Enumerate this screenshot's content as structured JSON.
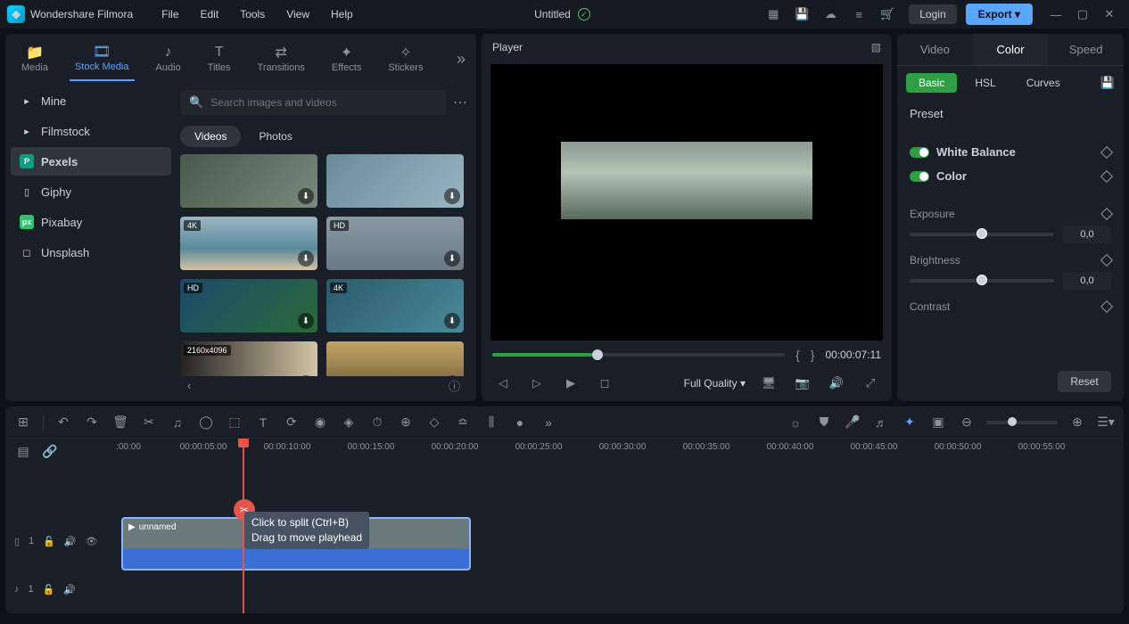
{
  "app": {
    "name": "Wondershare Filmora",
    "doc_title": "Untitled"
  },
  "menus": [
    "File",
    "Edit",
    "Tools",
    "View",
    "Help"
  ],
  "titlebar": {
    "login": "Login",
    "export": "Export ▾"
  },
  "tabs": {
    "media": "Media",
    "stock": "Stock Media",
    "audio": "Audio",
    "titles": "Titles",
    "transitions": "Transitions",
    "effects": "Effects",
    "stickers": "Stickers"
  },
  "sidebar": {
    "mine": "Mine",
    "filmstock": "Filmstock",
    "pexels": "Pexels",
    "giphy": "Giphy",
    "pixabay": "Pixabay",
    "unsplash": "Unsplash"
  },
  "search": {
    "placeholder": "Search images and videos"
  },
  "subtabs": {
    "videos": "Videos",
    "photos": "Photos"
  },
  "thumbs": {
    "b4k": "4K",
    "bhd": "HD",
    "bsize": "2160x4096"
  },
  "player": {
    "title": "Player",
    "timecode": "00:00:07:11",
    "quality": "Full Quality ▾"
  },
  "inspector": {
    "tabs": {
      "video": "Video",
      "color": "Color",
      "speed": "Speed"
    },
    "subtabs": {
      "basic": "Basic",
      "hsl": "HSL",
      "curves": "Curves"
    },
    "preset": "Preset",
    "wb": "White Balance",
    "color": "Color",
    "exposure": "Exposure",
    "brightness": "Brightness",
    "contrast": "Contrast",
    "zero": "0,0",
    "reset": "Reset"
  },
  "timeline": {
    "ticks": [
      ":00:00",
      "00:00:05:00",
      "00:00:10:00",
      "00:00:15:00",
      "00:00:20:00",
      "00:00:25:00",
      "00:00:30:00",
      "00:00:35:00",
      "00:00:40:00",
      "00:00:45:00",
      "00:00:50:00",
      "00:00:55:00"
    ],
    "clip_name": "unnamed",
    "tooltip_l1": "Click to split (Ctrl+B)",
    "tooltip_l2": "Drag to move playhead",
    "vtrack": "1",
    "atrack": "1"
  }
}
